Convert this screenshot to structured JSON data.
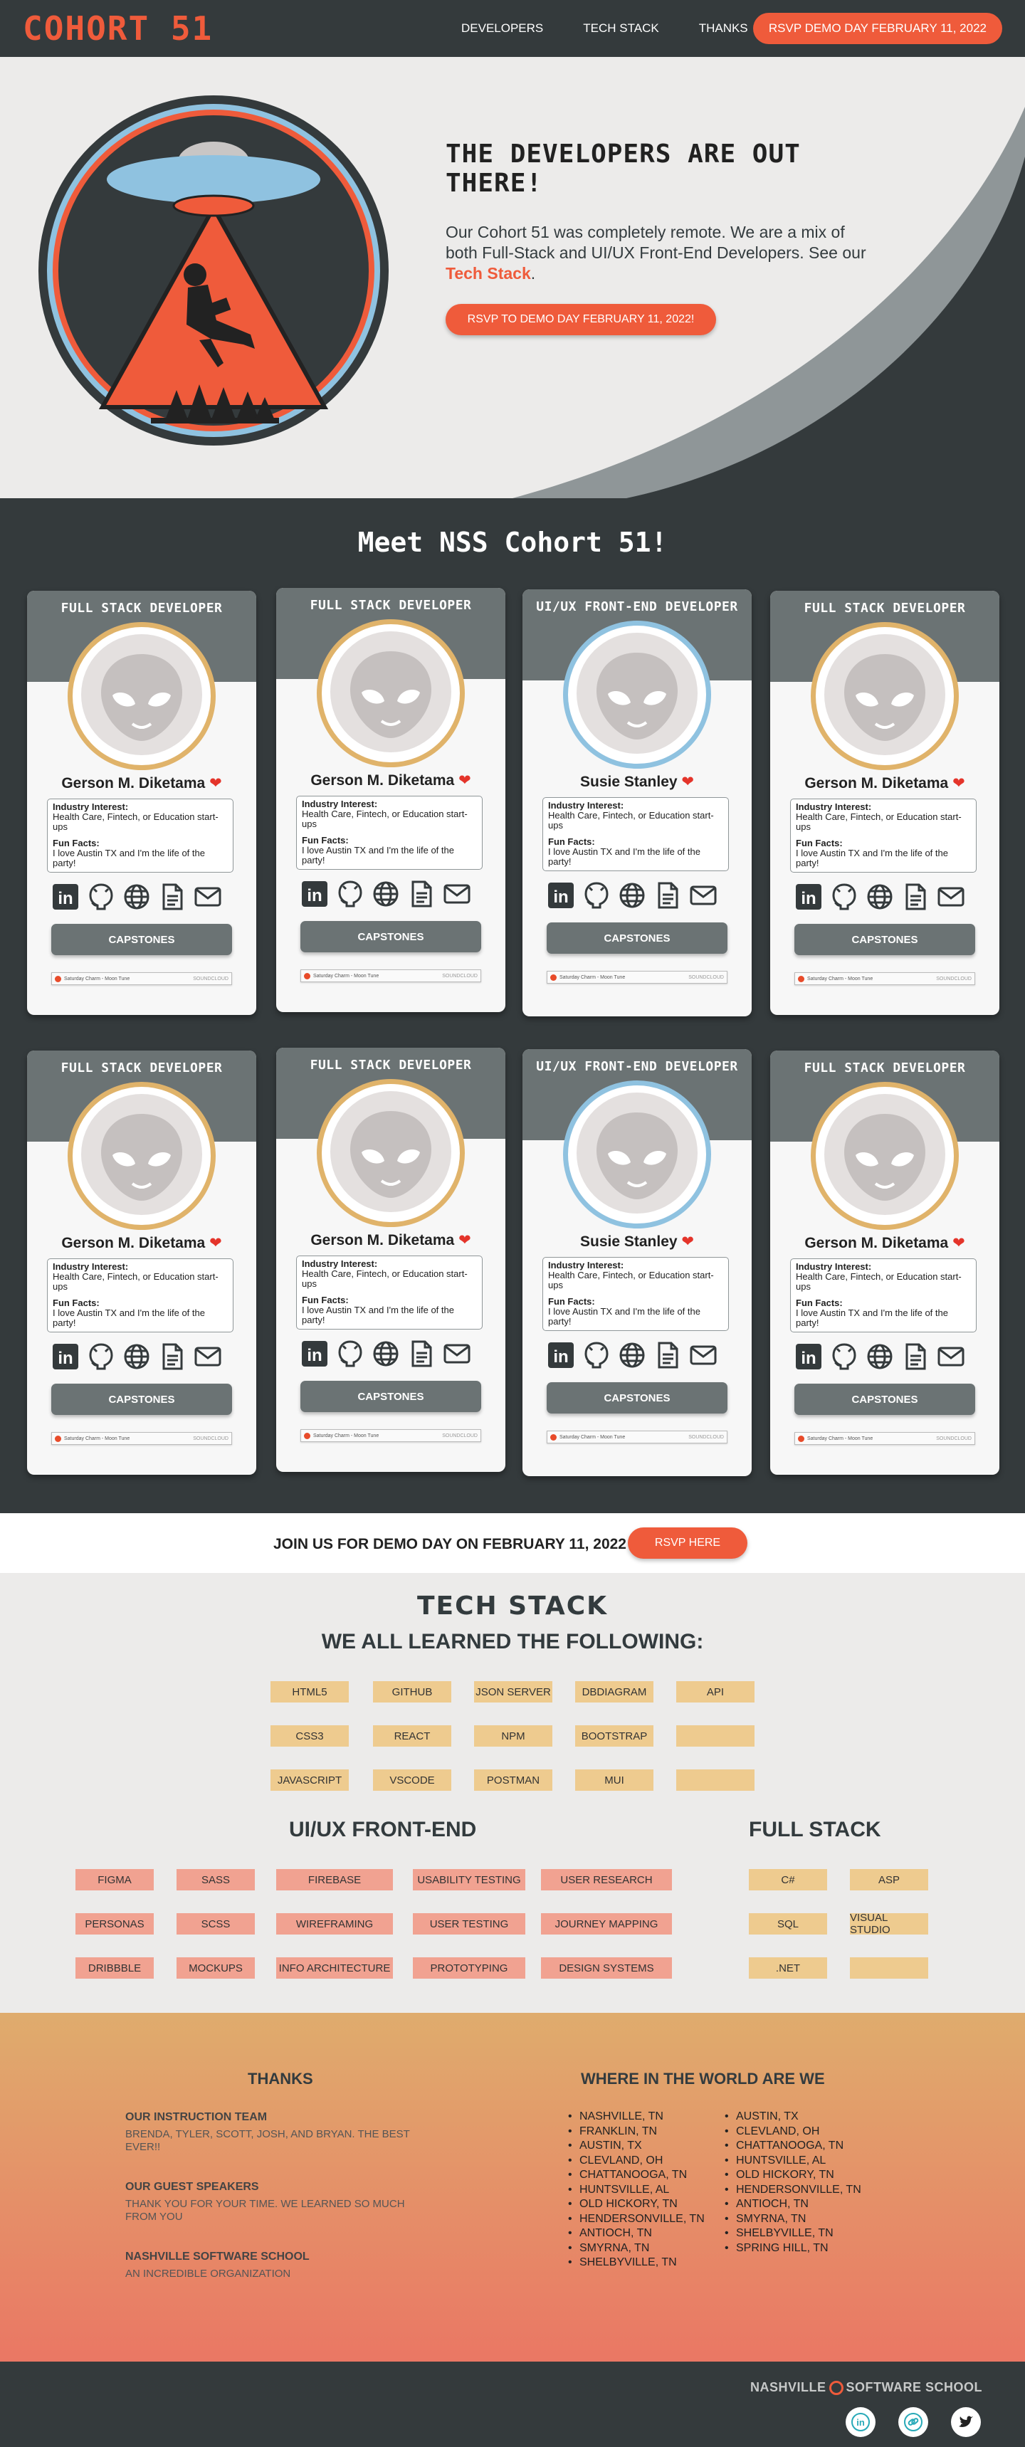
{
  "nav": {
    "brand": "COHORT 51",
    "links": [
      "DEVELOPERS",
      "TECH STACK",
      "THANKS"
    ],
    "rsvp": "RSVP DEMO DAY FEBRUARY 11, 2022"
  },
  "hero": {
    "title": "THE DEVELOPERS ARE OUT THERE!",
    "desc_main": "Our Cohort 51 was completely remote. We are a mix of both Full-Stack and UI/UX Front-End Developers. See our ",
    "desc_link": "Tech Stack",
    "desc_end": ".",
    "button": "RSVP  TO DEMO DAY FEBRUARY 11, 2022!"
  },
  "developers": {
    "title": "Meet NSS Cohort 51!",
    "interest_label": "Industry Interest:",
    "fun_label": "Fun Facts:",
    "capstones": "CAPSTONES",
    "player_track": "Saturday Charm - Moon Tune",
    "player_brand": "SOUNDCLOUD",
    "cards": [
      {
        "role": "FULL STACK DEVELOPER",
        "name": "Gerson M. Diketama",
        "interest": "Health Care, Fintech, or Education start-ups",
        "fun": "I love Austin TX and I'm the life of the party!"
      },
      {
        "role": "FULL STACK DEVELOPER",
        "name": "Gerson M. Diketama",
        "interest": "Health Care, Fintech, or Education start-ups",
        "fun": "I love Austin TX and I'm the life of the party!"
      },
      {
        "role": "UI/UX FRONT-END DEVELOPER",
        "name": "Susie Stanley",
        "interest": "Health Care, Fintech, or Education start-ups",
        "fun": "I love Austin TX and I'm the life of the party!"
      },
      {
        "role": "FULL STACK DEVELOPER",
        "name": "Gerson M. Diketama",
        "interest": "Health Care, Fintech, or Education start-ups",
        "fun": "I love Austin TX and I'm the life of the party!"
      },
      {
        "role": "FULL STACK DEVELOPER",
        "name": "Gerson M. Diketama",
        "interest": "Health Care, Fintech, or Education start-ups",
        "fun": "I love Austin TX and I'm the life of the party!"
      },
      {
        "role": "FULL STACK DEVELOPER",
        "name": "Gerson M. Diketama",
        "interest": "Health Care, Fintech, or Education start-ups",
        "fun": "I love Austin TX and I'm the life of the party!"
      },
      {
        "role": "UI/UX FRONT-END DEVELOPER",
        "name": "Susie Stanley",
        "interest": "Health Care, Fintech, or Education start-ups",
        "fun": "I love Austin TX and I'm the life of the party!"
      },
      {
        "role": "FULL STACK DEVELOPER",
        "name": "Gerson M. Diketama",
        "interest": "Health Care, Fintech, or Education start-ups",
        "fun": "I love Austin TX and I'm the life of the party!"
      }
    ]
  },
  "demo_bar": {
    "text": "JOIN US FOR DEMO DAY ON FEBRUARY 11, 2022",
    "button": "RSVP HERE"
  },
  "tech": {
    "title": "TECH STACK",
    "subtitle": "WE ALL LEARNED THE FOLLOWING:",
    "all": [
      "HTML5",
      "GITHUB",
      "JSON SERVER",
      "DBDIAGRAM",
      "API",
      "CSS3",
      "REACT",
      "NPM",
      "BOOTSTRAP",
      "",
      "JAVASCRIPT",
      "VSCODE",
      "POSTMAN",
      "MUI",
      ""
    ],
    "uiux_title": "UI/UX FRONT-END",
    "uiux": [
      "FIGMA",
      "SASS",
      "FIREBASE",
      "USABILITY TESTING",
      "USER RESEARCH",
      "PERSONAS",
      "SCSS",
      "WIREFRAMING",
      "USER TESTING",
      "JOURNEY MAPPING",
      "DRIBBBLE",
      "MOCKUPS",
      "INFO ARCHITECTURE",
      "PROTOTYPING",
      "DESIGN SYSTEMS"
    ],
    "fullstack_title": "FULL STACK",
    "fullstack": [
      "C#",
      "ASP",
      "SQL",
      "Visual Studio",
      ".NET",
      ""
    ]
  },
  "thanks": {
    "title": "THANKS",
    "items": [
      {
        "heading": "OUR INSTRUCTION TEAM",
        "text": "BRENDA, TYLER, SCOTT, JOSH, AND BRYAN. THE BEST EVER!!"
      },
      {
        "heading": "OUR GUEST SPEAKERS",
        "text": "THANK YOU FOR YOUR TIME. WE LEARNED SO MUCH FROM YOU"
      },
      {
        "heading": "NASHVILLE SOFTWARE SCHOOL",
        "text": "AN INCREDIBLE ORGANIZATION"
      }
    ],
    "where_title": "WHERE IN THE WORLD ARE WE",
    "locations_col1": [
      "NASHVILLE, TN",
      "FRANKLIN, TN",
      "AUSTIN, TX",
      "CLEVLAND, OH",
      "CHATTANOOGA, TN",
      "HUNTSVILLE, AL",
      "OLD HICKORY, TN",
      "HENDERSONVILLE, TN",
      "ANTIOCH, TN",
      "SMYRNA, TN",
      "SHELBYVILLE, TN"
    ],
    "locations_col2": [
      "AUSTIN, TX",
      "CLEVLAND, OH",
      "CHATTANOOGA, TN",
      "HUNTSVILLE, AL",
      "OLD HICKORY, TN",
      "HENDERSONVILLE, TN",
      "ANTIOCH, TN",
      "SMYRNA, TN",
      "SHELBYVILLE, TN",
      "SPRING HILL, TN"
    ]
  },
  "footer": {
    "nss_left": "NASHVILLE",
    "nss_right": "SOFTWARE SCHOOL",
    "social": [
      "linkedin-icon",
      "link-icon",
      "twitter-icon"
    ]
  },
  "colors": {
    "accent": "#ef5b3b",
    "dark": "#343a3c",
    "card_header": "#6b7374",
    "fullstack_ring": "#e0b36a",
    "uiux_ring": "#8fc2e0",
    "chip_yellow": "#eecb8f",
    "chip_pink": "#f1a291",
    "social_teal": "#27a9b8"
  }
}
